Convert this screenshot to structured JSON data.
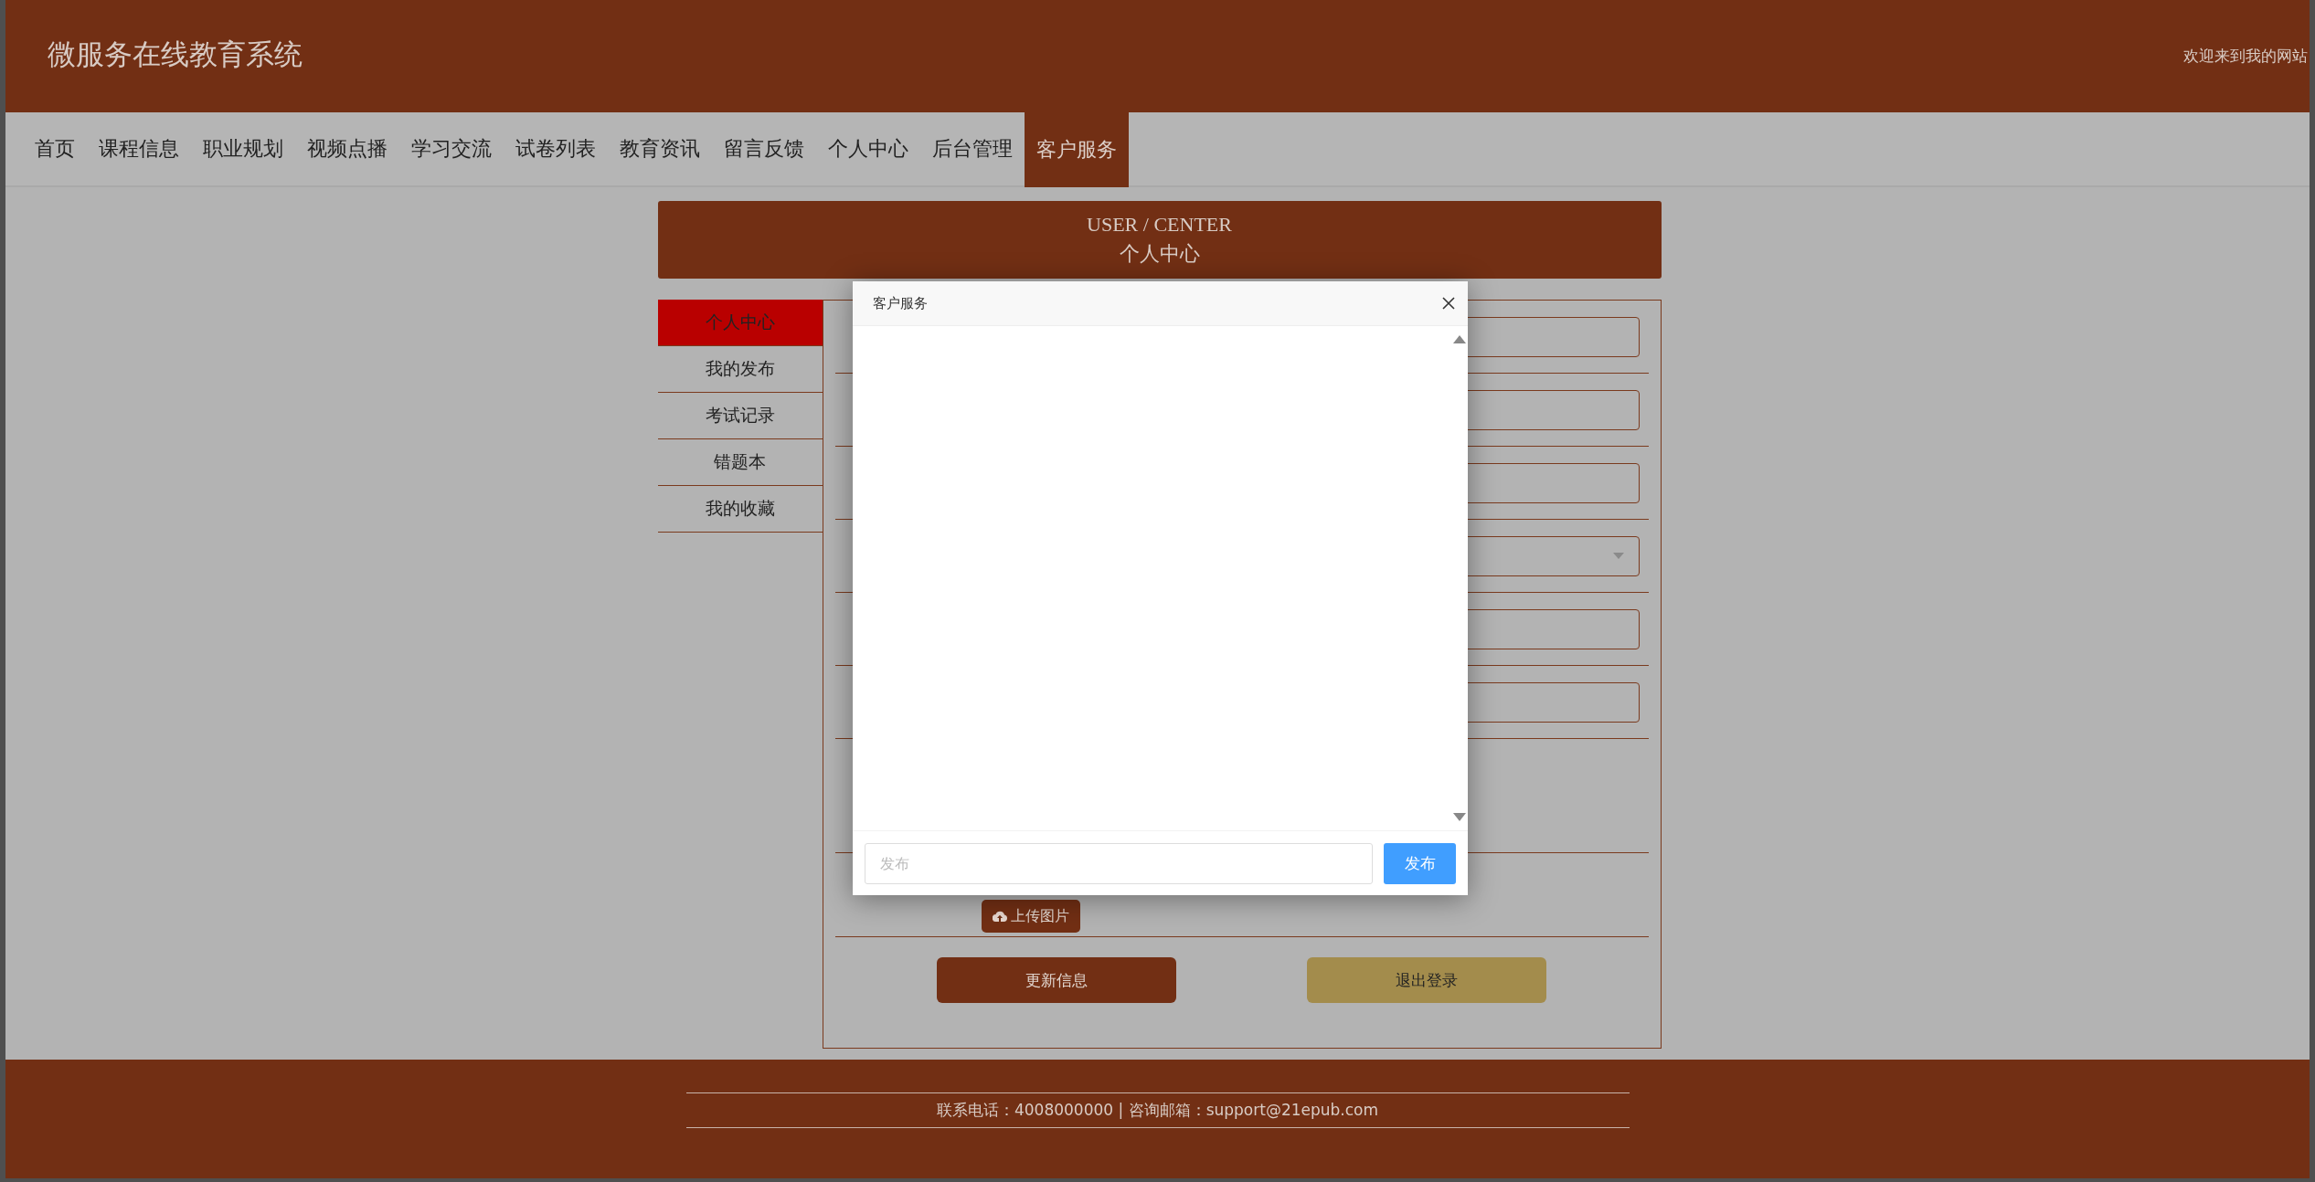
{
  "header": {
    "title": "微服务在线教育系统",
    "welcome": "欢迎来到我的网站"
  },
  "nav": [
    {
      "label": "首页",
      "selected": false
    },
    {
      "label": "课程信息",
      "selected": false
    },
    {
      "label": "职业规划",
      "selected": false
    },
    {
      "label": "视频点播",
      "selected": false
    },
    {
      "label": "学习交流",
      "selected": false
    },
    {
      "label": "试卷列表",
      "selected": false
    },
    {
      "label": "教育资讯",
      "selected": false
    },
    {
      "label": "留言反馈",
      "selected": false
    },
    {
      "label": "个人中心",
      "selected": false
    },
    {
      "label": "后台管理",
      "selected": false
    },
    {
      "label": "客户服务",
      "selected": true
    }
  ],
  "banner": {
    "title": "USER / CENTER",
    "subtitle": "个人中心"
  },
  "sidebar": [
    {
      "label": "个人中心",
      "selected": true
    },
    {
      "label": "我的发布",
      "selected": false
    },
    {
      "label": "考试记录",
      "selected": false
    },
    {
      "label": "错题本",
      "selected": false
    },
    {
      "label": "我的收藏",
      "selected": false
    }
  ],
  "form": {
    "fields": [
      {
        "kind": "text"
      },
      {
        "kind": "text"
      },
      {
        "kind": "text"
      },
      {
        "kind": "select"
      },
      {
        "kind": "text"
      },
      {
        "kind": "text"
      }
    ],
    "upload_button": "上传图片",
    "update_button": "更新信息",
    "logout_button": "退出登录"
  },
  "footer": {
    "text": "联系电话：4008000000 | 咨询邮箱：support@21epub.com"
  },
  "dialog": {
    "title": "客户服务",
    "message_input": {
      "placeholder": "发布"
    },
    "send_button": "发布"
  }
}
